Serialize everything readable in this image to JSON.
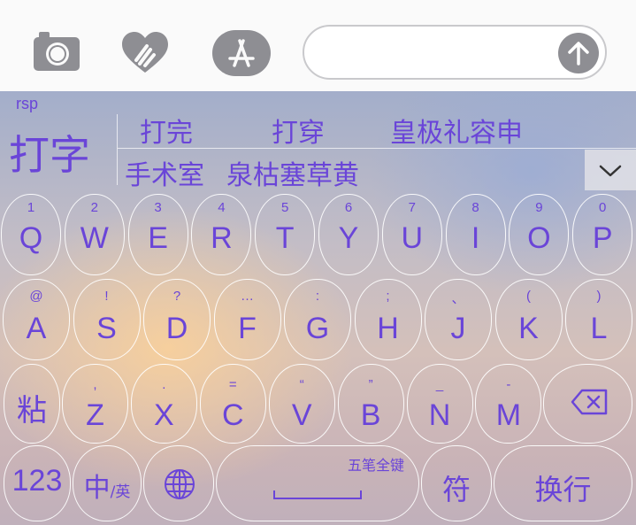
{
  "toolbar": {
    "camera_icon": "camera-icon",
    "digital_touch_icon": "heart-hands-icon",
    "app_store_icon": "app-store-icon",
    "message_value": "",
    "send_icon": "arrow-up-icon"
  },
  "ime": {
    "pinyin": "rsp",
    "composed": "打字",
    "candidates_row1": [
      "打完",
      "打穿",
      "皇极礼容申"
    ],
    "candidates_row2": [
      "手术室",
      "泉枯塞草黄"
    ],
    "expand_icon": "chevron-down-icon"
  },
  "keyboard": {
    "row1": [
      {
        "main": "Q",
        "sub": "1"
      },
      {
        "main": "W",
        "sub": "2"
      },
      {
        "main": "E",
        "sub": "3"
      },
      {
        "main": "R",
        "sub": "4"
      },
      {
        "main": "T",
        "sub": "5"
      },
      {
        "main": "Y",
        "sub": "6"
      },
      {
        "main": "U",
        "sub": "7"
      },
      {
        "main": "I",
        "sub": "8"
      },
      {
        "main": "O",
        "sub": "9"
      },
      {
        "main": "P",
        "sub": "0"
      }
    ],
    "row2": [
      {
        "main": "A",
        "sub": "@"
      },
      {
        "main": "S",
        "sub": "!"
      },
      {
        "main": "D",
        "sub": "?"
      },
      {
        "main": "F",
        "sub": "…"
      },
      {
        "main": "G",
        "sub": ":"
      },
      {
        "main": "H",
        "sub": ";"
      },
      {
        "main": "J",
        "sub": "、"
      },
      {
        "main": "K",
        "sub": "("
      },
      {
        "main": "L",
        "sub": ")"
      }
    ],
    "row3_left": "粘",
    "row3": [
      {
        "main": "Z",
        "sub": ","
      },
      {
        "main": "X",
        "sub": "."
      },
      {
        "main": "C",
        "sub": "="
      },
      {
        "main": "V",
        "sub": "“"
      },
      {
        "main": "B",
        "sub": "”"
      },
      {
        "main": "N",
        "sub": "_"
      },
      {
        "main": "M",
        "sub": "-"
      }
    ],
    "delete_icon": "backspace-icon",
    "numbers_label": "123",
    "lang_main": "中",
    "lang_sub": "/英",
    "globe_icon": "globe-icon",
    "space_label": "五笔全键",
    "symbols_label": "符",
    "return_label": "换行"
  },
  "colors": {
    "accent": "#6a45d8",
    "toolbar_icon": "#8e8e93"
  }
}
